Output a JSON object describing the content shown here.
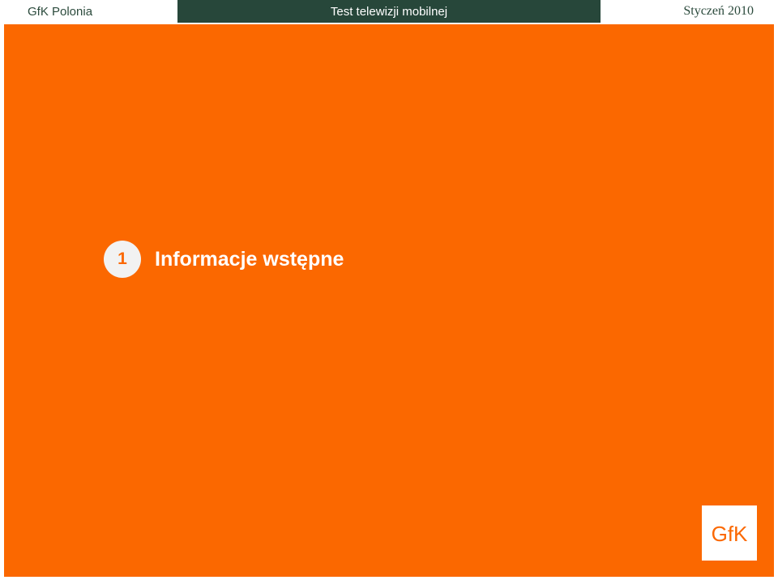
{
  "header": {
    "left_label": "GfK Polonia",
    "center_label": "Test telewizji mobilnej",
    "right_label": "Styczeń 2010"
  },
  "section": {
    "number": "1",
    "title": "Informacje wstępne"
  },
  "logo": {
    "text": "GfK",
    "icon": "gfk-logo-icon"
  },
  "colors": {
    "accent_orange": "#fb6800",
    "header_green": "#27473a",
    "badge_gray": "#f2f2f2",
    "text_white": "#ffffff"
  }
}
